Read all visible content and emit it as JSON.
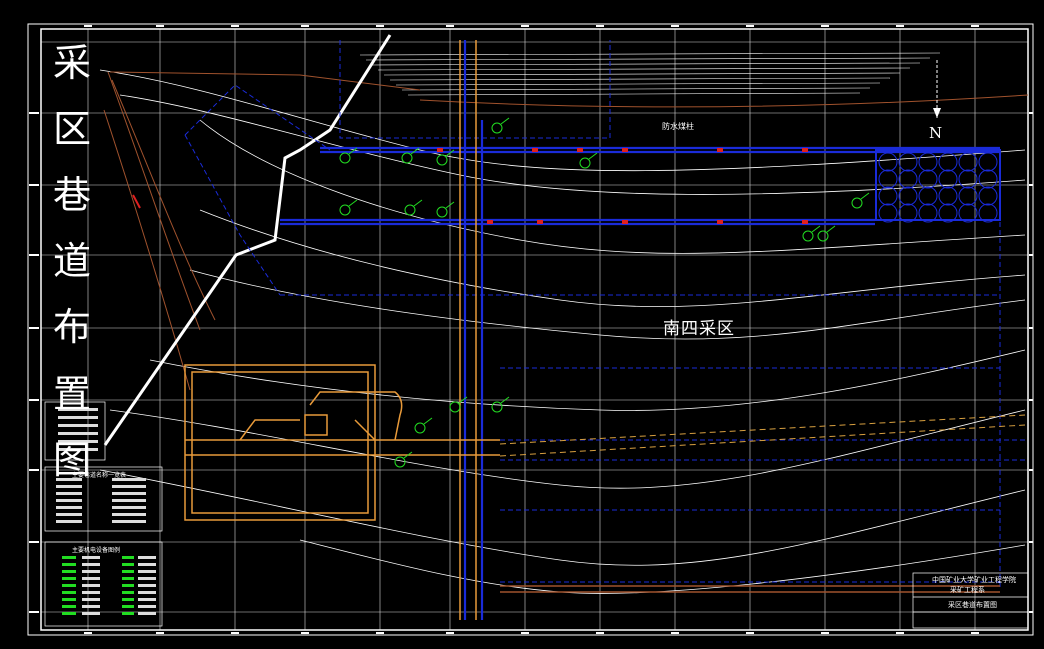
{
  "drawing": {
    "vertical_title_chars": [
      "采",
      "区",
      "巷",
      "道",
      "布",
      "置",
      "图"
    ],
    "area_label": "南四采区",
    "north_label": "N",
    "waterproof_label": "防水煤柱",
    "table1_title": "主要巷道名称一览表",
    "table2_title": "主要机电设备图例",
    "title_block": {
      "line1": "中国矿业大学矿业工程学院",
      "line2": "采矿工程系",
      "line3": "采区巷道布置图"
    }
  },
  "colors": {
    "background": "#000000",
    "frame": "#ffffff",
    "roadway_blue": "#1a2bd9",
    "contour": "#ffffff",
    "shaft_orange": "#e89a3a",
    "equipment_green": "#22dd22",
    "fault_red": "#e02020",
    "boundary_brown": "#a0522d"
  }
}
